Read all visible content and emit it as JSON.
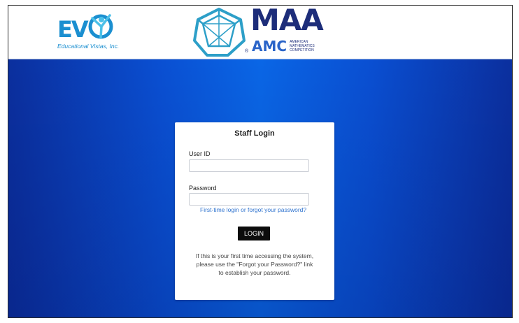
{
  "header": {
    "evi_logo": {
      "letters": "EV",
      "tagline": "Educational Vistas, Inc."
    },
    "maa_logo": {
      "title": "MAA",
      "amc": "AMC",
      "amc_sub": [
        "AMERICAN",
        "MATHEMATICS",
        "COMPETITION"
      ],
      "reg": "®"
    }
  },
  "colors": {
    "hero_blue": "#0a5fe0",
    "evi_blue": "#1b8fd0",
    "maa_navy": "#1d2d7a",
    "link_blue": "#2f73cf",
    "button_black": "#0c0c0c"
  },
  "login": {
    "title": "Staff Login",
    "user_id_label": "User ID",
    "user_id_value": "",
    "password_label": "Password",
    "password_value": "",
    "forgot_link": "First-time login or forgot your password?",
    "login_button": "LOGIN",
    "help_lines": [
      "If this is your first time accessing the system,",
      "please use the \"Forgot your Password?\" link",
      "to establish your password."
    ]
  }
}
